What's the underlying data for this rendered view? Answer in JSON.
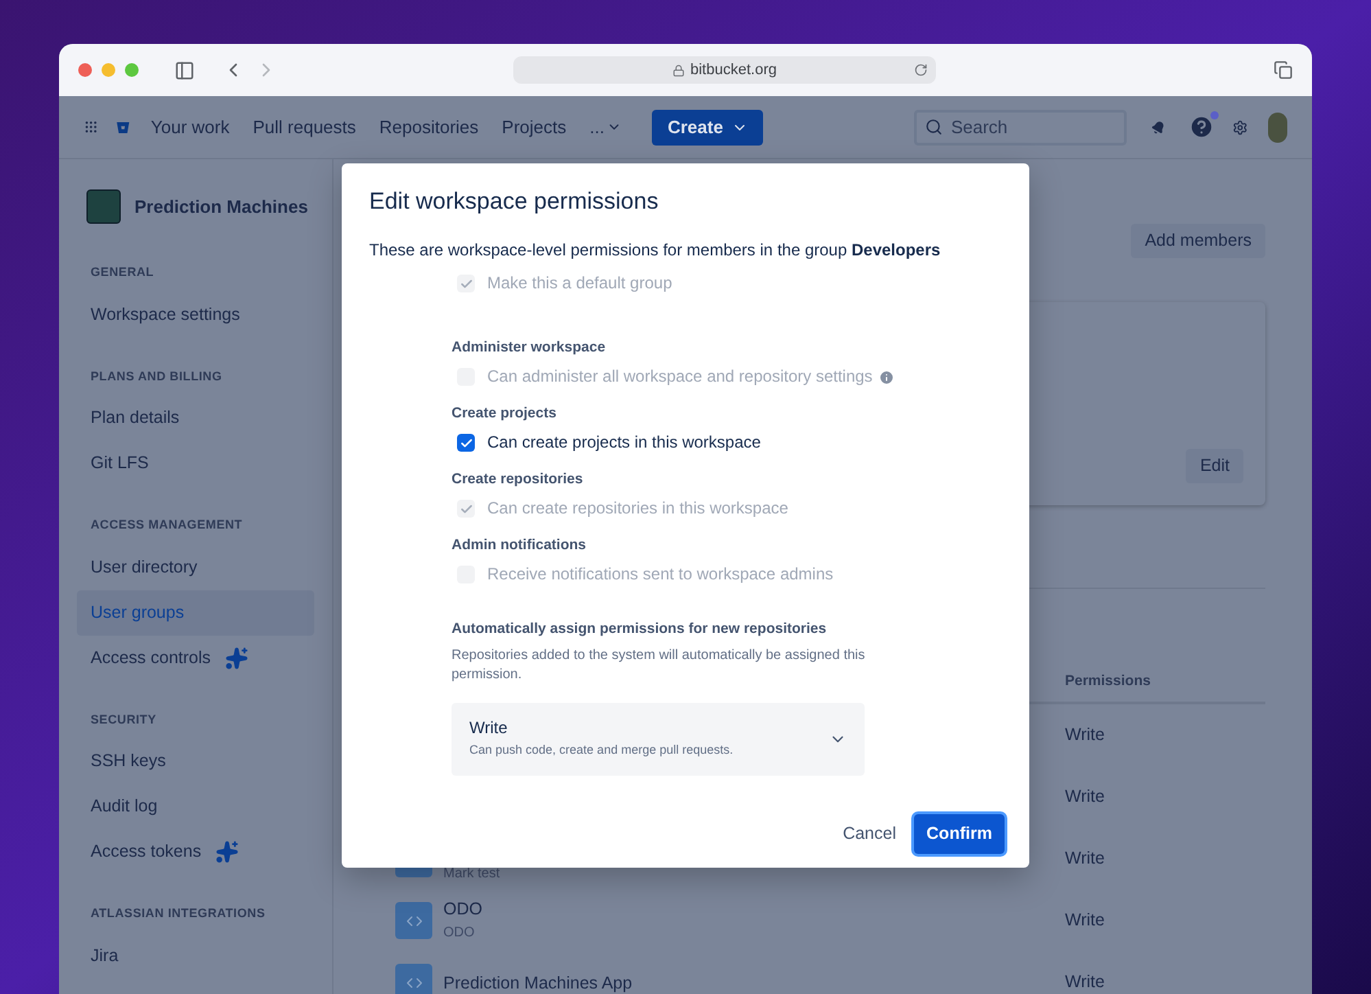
{
  "browser": {
    "url": "bitbucket.org"
  },
  "nav": {
    "items": [
      "Your work",
      "Pull requests",
      "Repositories",
      "Projects"
    ],
    "more": "...",
    "create": "Create",
    "search_placeholder": "Search",
    "help_notification": true
  },
  "sidebar": {
    "workspace": "Prediction Machines",
    "sections": [
      {
        "heading": "GENERAL",
        "items": [
          {
            "label": "Workspace settings",
            "selected": false,
            "sparkle": false
          }
        ]
      },
      {
        "heading": "PLANS AND BILLING",
        "items": [
          {
            "label": "Plan details",
            "selected": false,
            "sparkle": false
          },
          {
            "label": "Git LFS",
            "selected": false,
            "sparkle": false
          }
        ]
      },
      {
        "heading": "ACCESS MANAGEMENT",
        "items": [
          {
            "label": "User directory",
            "selected": false,
            "sparkle": false
          },
          {
            "label": "User groups",
            "selected": true,
            "sparkle": false
          },
          {
            "label": "Access controls",
            "selected": false,
            "sparkle": true
          }
        ]
      },
      {
        "heading": "SECURITY",
        "items": [
          {
            "label": "SSH keys",
            "selected": false,
            "sparkle": false
          },
          {
            "label": "Audit log",
            "selected": false,
            "sparkle": false
          },
          {
            "label": "Access tokens",
            "selected": false,
            "sparkle": true
          }
        ]
      },
      {
        "heading": "ATLASSIAN INTEGRATIONS",
        "items": [
          {
            "label": "Jira",
            "selected": false,
            "sparkle": false
          }
        ]
      }
    ]
  },
  "main": {
    "add_members": "Add members",
    "edit": "Edit",
    "permissions_header": "Permissions",
    "rows": [
      {
        "permission": "Write"
      },
      {
        "permission": "Write"
      },
      {
        "subtitle": "Mark test",
        "permission": "Write"
      },
      {
        "name": "ODO",
        "subtitle": "ODO",
        "permission": "Write"
      },
      {
        "name": "Prediction Machines App",
        "permission": "Write"
      }
    ]
  },
  "dialog": {
    "title": "Edit workspace permissions",
    "description": "These are workspace-level permissions for members in the group **Developers**",
    "options": [
      {
        "label": "Make this a default group",
        "checked": true,
        "disabled": true,
        "info": false
      },
      {
        "heading": "Administer workspace",
        "label": "Can administer all workspace and repository settings",
        "checked": false,
        "disabled": true,
        "info": true
      },
      {
        "heading": "Create projects",
        "label": "Can create projects in this workspace",
        "checked": true,
        "disabled": false,
        "info": false
      },
      {
        "heading": "Create repositories",
        "label": "Can create repositories in this workspace",
        "checked": true,
        "disabled": true,
        "info": false
      },
      {
        "heading": "Admin notifications",
        "label": "Receive notifications sent to workspace admins",
        "checked": false,
        "disabled": true,
        "info": false
      }
    ],
    "auto_heading": "Automatically assign permissions for new repositories",
    "auto_description": "Repositories added to the system will automatically be assigned this permission.",
    "select": {
      "value": "Write",
      "description": "Can push code, create and merge pull requests."
    },
    "cancel": "Cancel",
    "confirm": "Confirm"
  }
}
